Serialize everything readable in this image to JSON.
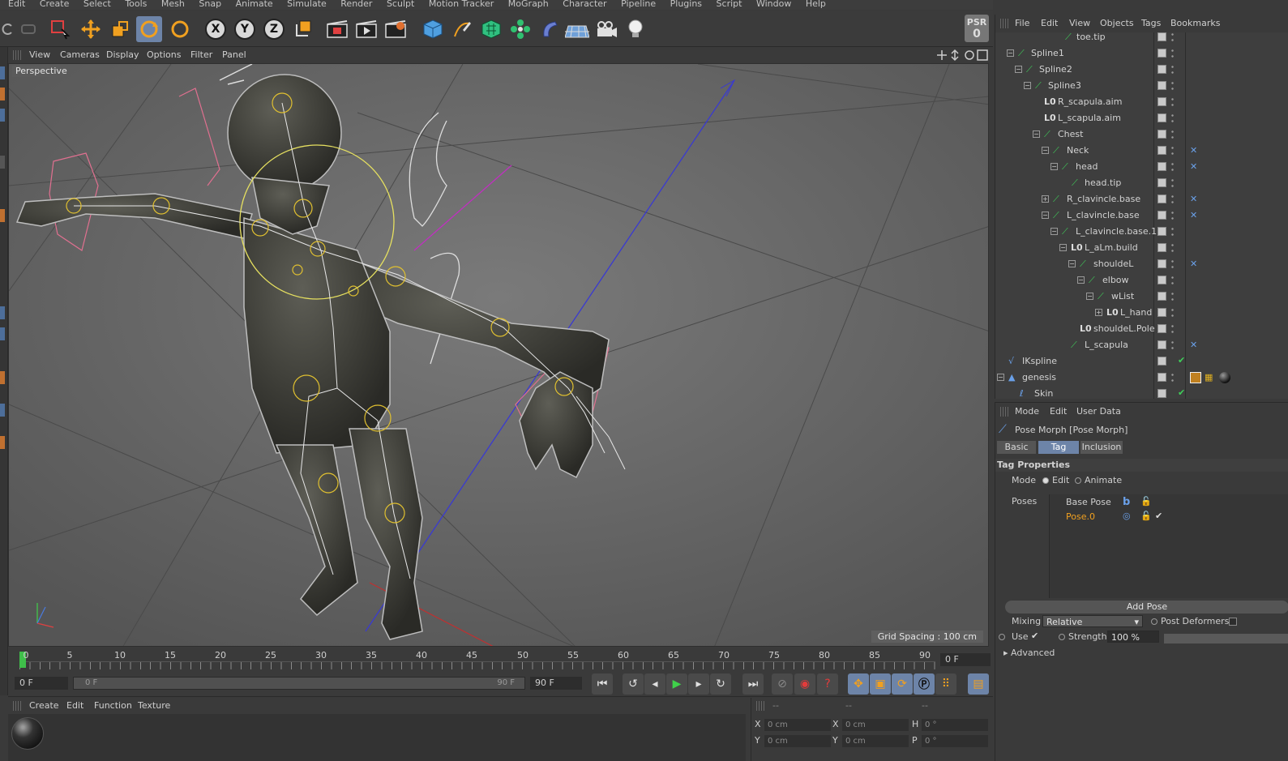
{
  "menubar": [
    "Edit",
    "Create",
    "Select",
    "Tools",
    "Mesh",
    "Snap",
    "Animate",
    "Simulate",
    "Render",
    "Sculpt",
    "Motion Tracker",
    "MoGraph",
    "Character",
    "Pipeline",
    "Plugins",
    "Script",
    "Window",
    "Help"
  ],
  "toolbar": {
    "axis_x": "X",
    "axis_y": "Y",
    "axis_z": "Z",
    "psr_line1": "PSR",
    "psr_line2": "0"
  },
  "viewport": {
    "menu": [
      "View",
      "Cameras",
      "Display",
      "Options",
      "Filter",
      "Panel"
    ],
    "label": "Perspective",
    "grid_spacing": "Grid Spacing : 100 cm",
    "colors": {
      "background": "#6b6b6b",
      "figure": "#3e3e38",
      "selection_circle": "#e6e060",
      "joint": "#e0c030"
    }
  },
  "timeline": {
    "ticks": [
      "0",
      "5",
      "10",
      "15",
      "20",
      "25",
      "30",
      "35",
      "40",
      "45",
      "50",
      "55",
      "60",
      "65",
      "70",
      "75",
      "80",
      "85",
      "90"
    ],
    "current_frame": "0 F"
  },
  "transport": {
    "start_field": "0 F",
    "range_start": "0 F",
    "range_end": "90 F",
    "end_field": "90 F"
  },
  "material_manager": {
    "menu": [
      "Create",
      "Edit",
      "Function",
      "Texture"
    ]
  },
  "coordinates": {
    "header": [
      "--",
      "--",
      "--"
    ],
    "row1": {
      "a": "X",
      "a_val": "0 cm",
      "b": "X",
      "b_val": "0 cm",
      "c": "H",
      "c_val": "0 °"
    },
    "row2": {
      "a": "Y",
      "a_val": "0 cm",
      "b": "Y",
      "b_val": "0 cm",
      "c": "P",
      "c_val": "0 °"
    }
  },
  "object_manager": {
    "menu": [
      "File",
      "Edit",
      "View",
      "Objects",
      "Tags",
      "Bookmarks"
    ],
    "rows": [
      {
        "name": "toe.tip",
        "indent": 6
      },
      {
        "name": "Spline1",
        "indent": 1
      },
      {
        "name": "Spline2",
        "indent": 2
      },
      {
        "name": "Spline3",
        "indent": 3
      },
      {
        "name": "R_scapula.aim",
        "indent": 4
      },
      {
        "name": "L_scapula.aim",
        "indent": 4
      },
      {
        "name": "Chest",
        "indent": 4
      },
      {
        "name": "Neck",
        "indent": 5
      },
      {
        "name": "head",
        "indent": 6
      },
      {
        "name": "head.tip",
        "indent": 7
      },
      {
        "name": "R_clavincle.base",
        "indent": 5
      },
      {
        "name": "L_clavincle.base",
        "indent": 5
      },
      {
        "name": "L_clavincle.base.1",
        "indent": 6
      },
      {
        "name": "L_aLm.build",
        "indent": 7
      },
      {
        "name": "shouldeL",
        "indent": 8
      },
      {
        "name": "elbow",
        "indent": 9
      },
      {
        "name": "wList",
        "indent": 10
      },
      {
        "name": "L_hand",
        "indent": 11
      },
      {
        "name": "shouldeL.Pole",
        "indent": 9
      },
      {
        "name": "L_scapula",
        "indent": 8
      },
      {
        "name": "IKspline",
        "indent": 1
      },
      {
        "name": "genesis",
        "indent": 0
      },
      {
        "name": "Skin",
        "indent": 2
      }
    ]
  },
  "attribute_manager": {
    "menu": [
      "Mode",
      "Edit",
      "User Data"
    ],
    "title": "Pose Morph [Pose Morph]",
    "tabs": [
      "Basic",
      "Tag",
      "Inclusion"
    ],
    "section": "Tag Properties",
    "mode_label": "Mode",
    "mode_edit": "Edit",
    "mode_animate": "Animate",
    "poses_label": "Poses",
    "poses": [
      "Base Pose",
      "Pose.0"
    ],
    "add_pose": "Add Pose",
    "mixing_label": "Mixing",
    "mixing_value": "Relative",
    "post_deformers": "Post Deformers",
    "use_label": "Use",
    "strength_label": "Strength",
    "strength_value": "100 %",
    "advanced": "Advanced"
  }
}
